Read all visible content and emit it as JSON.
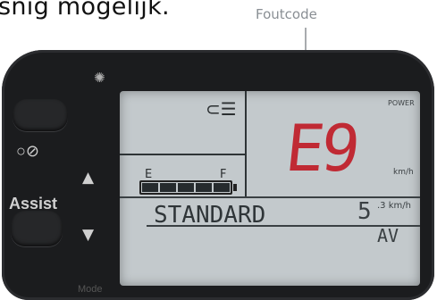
{
  "caption": "snig mogelijk.",
  "callout": {
    "label": "Foutcode"
  },
  "device": {
    "buttons": {
      "assist_label": "Assist",
      "icons_label": "○⊘",
      "mode_label": "Mode"
    },
    "lcd": {
      "error_code": "E9",
      "power_label": "POWER",
      "speed_unit": "km/h",
      "mode_text": "STANDARD",
      "small_speed": "5",
      "small_speed_unit": ".3 km/h",
      "trip_label": "AV",
      "battery": {
        "empty_label": "E",
        "full_label": "F",
        "level": 1.0
      },
      "light_icon": "headlight-icon"
    }
  }
}
